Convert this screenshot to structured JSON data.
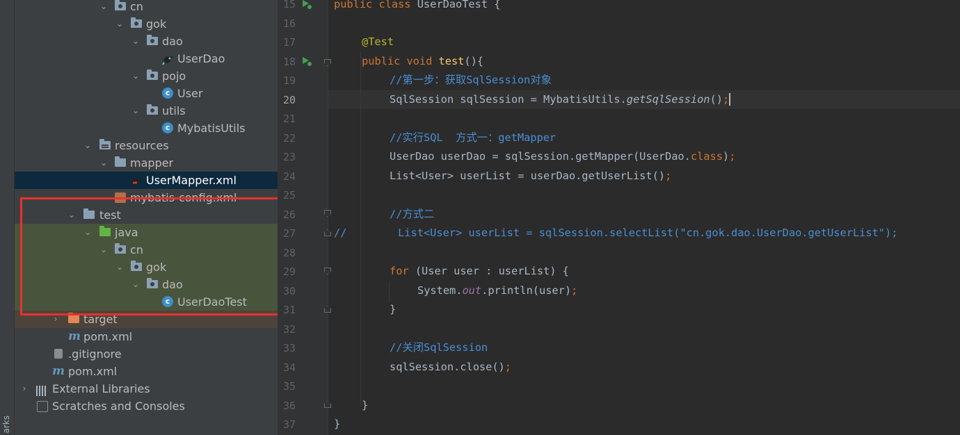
{
  "left_strip": {
    "label": "arks"
  },
  "tree": [
    {
      "label": "cn",
      "icon": "package-folder-icon",
      "expanded": true
    },
    {
      "label": "gok",
      "icon": "package-folder-icon",
      "expanded": true
    },
    {
      "label": "dao",
      "icon": "package-folder-icon",
      "expanded": true
    },
    {
      "label": "UserDao",
      "icon": "mybatis-interface-icon"
    },
    {
      "label": "pojo",
      "icon": "package-folder-icon",
      "expanded": true
    },
    {
      "label": "User",
      "icon": "class-icon"
    },
    {
      "label": "utils",
      "icon": "package-folder-icon",
      "expanded": true
    },
    {
      "label": "MybatisUtils",
      "icon": "class-icon"
    },
    {
      "label": "resources",
      "icon": "resources-folder-icon",
      "expanded": true
    },
    {
      "label": "mapper",
      "icon": "folder-icon",
      "expanded": true
    },
    {
      "label": "UserMapper.xml",
      "icon": "mybatis-xml-icon",
      "selected": true
    },
    {
      "label": "mybatis-config.xml",
      "icon": "xml-icon"
    },
    {
      "label": "test",
      "icon": "folder-icon",
      "expanded": true
    },
    {
      "label": "java",
      "icon": "test-source-folder-icon",
      "expanded": true
    },
    {
      "label": "cn",
      "icon": "package-folder-icon",
      "expanded": true
    },
    {
      "label": "gok",
      "icon": "package-folder-icon",
      "expanded": true
    },
    {
      "label": "dao",
      "icon": "package-folder-icon",
      "expanded": true
    },
    {
      "label": "UserDaoTest",
      "icon": "test-class-icon"
    },
    {
      "label": "target",
      "icon": "excluded-folder-icon",
      "expanded": false
    },
    {
      "label": "pom.xml",
      "icon": "maven-icon"
    },
    {
      "label": ".gitignore",
      "icon": "gitignore-icon"
    },
    {
      "label": "pom.xml",
      "icon": "maven-icon"
    },
    {
      "label": "External Libraries",
      "icon": "libraries-icon",
      "expanded": false
    },
    {
      "label": "Scratches and Consoles",
      "icon": "scratches-icon"
    }
  ],
  "editor": {
    "line_numbers": [
      "15",
      "16",
      "17",
      "18",
      "19",
      "20",
      "21",
      "22",
      "23",
      "24",
      "25",
      "26",
      "27",
      "28",
      "29",
      "30",
      "31",
      "32",
      "33",
      "34",
      "35",
      "36",
      "37"
    ],
    "current_line": "20",
    "lines": {
      "l15": {
        "kw1": "public class",
        "rest": " UserDaoTest {"
      },
      "l17": {
        "ann": "@Test"
      },
      "l18": {
        "kw": "public void",
        "fn": " test",
        "rest": "(){"
      },
      "l19": {
        "cmt": "//第一步：获取SqlSession对象"
      },
      "l20": {
        "a": "SqlSession sqlSession = MybatisUtils.",
        "it": "getSqlSession",
        "b": "()",
        "semi": ";"
      },
      "l22": {
        "cmt": "//实行SQL  方式一：getMapper"
      },
      "l23": {
        "a": "UserDao userDao = sqlSession.getMapper(UserDao.",
        "kw": "class",
        "b": ")",
        "semi": ";"
      },
      "l24": {
        "a": "List<User> userList = userDao.getUserList()",
        "semi": ";"
      },
      "l26": {
        "cmt": "//方式二"
      },
      "l27": {
        "slash": "//",
        "a": "        List<User> userList = sqlSession.selectList(\"cn.gok.dao.UserDao.getUserList\");"
      },
      "l29": {
        "kw": "for",
        "a": " (User user : userList) {"
      },
      "l30": {
        "a": "System.",
        "fld": "out",
        "b": ".println(user)",
        "semi": ";"
      },
      "l31": {
        "a": "}"
      },
      "l33": {
        "cmt": "//关闭SqlSession"
      },
      "l34": {
        "a": "sqlSession.close()",
        "semi": ";"
      },
      "l36": {
        "a": "}"
      },
      "l37": {
        "a": "}"
      }
    }
  },
  "colors": {
    "keyword": "#cc7832",
    "annotation": "#bbb529",
    "comment": "#4a8ed4",
    "function": "#ffc66d",
    "highlight_box": "#e8322d"
  }
}
